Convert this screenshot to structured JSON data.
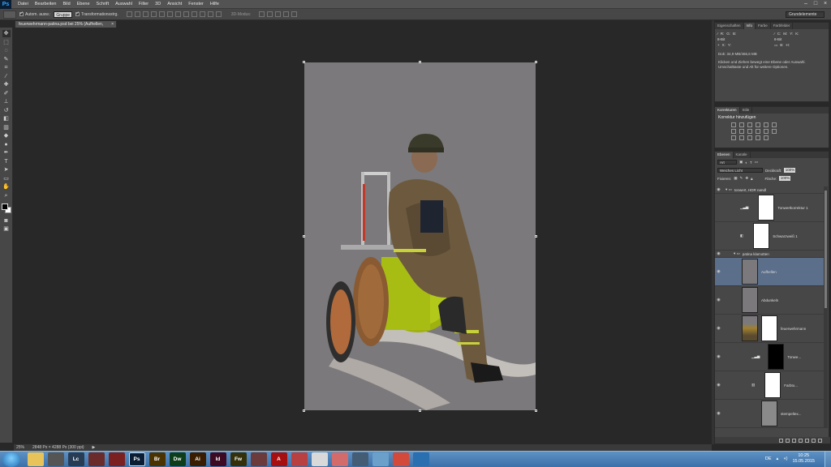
{
  "menubar": {
    "logo": "Ps",
    "items": [
      "Datei",
      "Bearbeiten",
      "Bild",
      "Ebene",
      "Schrift",
      "Auswahl",
      "Filter",
      "3D",
      "Ansicht",
      "Fenster",
      "Hilfe"
    ]
  },
  "options": {
    "auto_select_label": "Autom. ausw.:",
    "auto_select_value": "Gruppe",
    "transform_label": "Transformationsstrg.",
    "mode3d": "3D-Modus:",
    "workspace": "Grundelemente"
  },
  "document": {
    "tab_title": "feuerwehrmann-patina.psd bei 25% (Aufhellen, RGB/8)",
    "close": "×"
  },
  "status": {
    "zoom": "25%",
    "doc_size": "2848 Px × 4288 Px (300 ppi)"
  },
  "panels": {
    "info_tabs": [
      "Eigenschaften",
      "Info",
      "Farbe",
      "Farbfelder"
    ],
    "info": {
      "r_label": "R:",
      "g_label": "G:",
      "b_label": "B:",
      "c_label": "C:",
      "m_label": "M:",
      "y_label": "Y:",
      "k_label": "K:",
      "bit1": "8-Bit",
      "bit2": "8-Bit",
      "x_label": "X:",
      "y2_label": "Y:",
      "w_label": "B:",
      "h_label": "H:",
      "doc_line": "Dok: 34,9 MB/466,6 MB",
      "help_text": "Klicken und Ziehen bewegt eine Ebene oder Auswahl. Umschalttaste und Alt für weitere Optionen."
    },
    "adjust_tabs": [
      "Korrekturen",
      "Stile"
    ],
    "adjust_title": "Korrektur hinzufügen",
    "layers_tabs": [
      "Ebenen",
      "Kanäle"
    ],
    "layers": {
      "kind": "Art",
      "blend": "Weiches Licht",
      "opacity_label": "Deckkraft:",
      "opacity": "100%",
      "lock_label": "Fixieren:",
      "fill_label": "Fläche:",
      "fill": "100%",
      "items": [
        {
          "name": "tonwert, HDR nandl",
          "kind": "group"
        },
        {
          "name": "Tonwertkorrektur 1",
          "kind": "adj"
        },
        {
          "name": "Schwarzweiß 1",
          "kind": "adj"
        },
        {
          "name": "patina klamotten",
          "kind": "group"
        },
        {
          "name": "Aufhellen",
          "kind": "gray",
          "selected": true
        },
        {
          "name": "Abdunkeln",
          "kind": "gray"
        },
        {
          "name": "feuerwehrmann",
          "kind": "photo"
        },
        {
          "name": "Tonwe...",
          "kind": "adjblack"
        },
        {
          "name": "Farbto...",
          "kind": "adjwhite"
        },
        {
          "name": "stempeltex...",
          "kind": "gray"
        },
        {
          "name": "",
          "kind": "pattern"
        }
      ]
    }
  },
  "taskbar": {
    "apps": [
      {
        "id": "explorer",
        "label": "",
        "color": "#e8c35a"
      },
      {
        "id": "misc1",
        "label": "",
        "color": "#555"
      },
      {
        "id": "lightroom",
        "label": "Lc",
        "color": "#283c54"
      },
      {
        "id": "misc2",
        "label": "",
        "color": "#6b2b2b"
      },
      {
        "id": "misc3",
        "label": "",
        "color": "#7a2020"
      },
      {
        "id": "photoshop",
        "label": "Ps",
        "color": "#0a1d33"
      },
      {
        "id": "bridge",
        "label": "Br",
        "color": "#4a3300"
      },
      {
        "id": "dreamweaver",
        "label": "Dw",
        "color": "#0e3d1a"
      },
      {
        "id": "illustrator",
        "label": "Ai",
        "color": "#3a1c00"
      },
      {
        "id": "indesign",
        "label": "Id",
        "color": "#3c0a22"
      },
      {
        "id": "fireworks",
        "label": "Fw",
        "color": "#33300a"
      },
      {
        "id": "misc4",
        "label": "",
        "color": "#6b3a3a"
      },
      {
        "id": "acrobat",
        "label": "A",
        "color": "#a50f0f"
      },
      {
        "id": "misc5",
        "label": "",
        "color": "#b84040"
      },
      {
        "id": "reader",
        "label": "",
        "color": "#d9d9d9"
      },
      {
        "id": "misc6",
        "label": "",
        "color": "#d36b6b"
      },
      {
        "id": "monitor",
        "label": "",
        "color": "#445c74"
      },
      {
        "id": "misc7",
        "label": "",
        "color": "#6aa0c9"
      },
      {
        "id": "chrome",
        "label": "",
        "color": "#d34a3a"
      },
      {
        "id": "misc8",
        "label": "",
        "color": "#2a6fb0"
      }
    ],
    "lang": "DE",
    "time": "10:25",
    "date": "15.05.2015"
  }
}
